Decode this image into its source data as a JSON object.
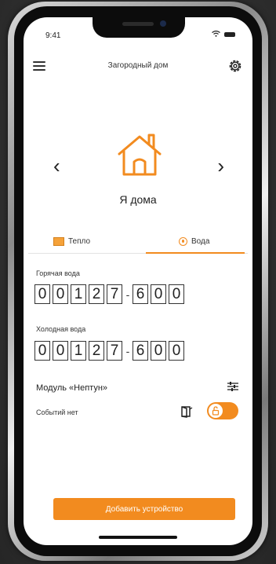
{
  "status_bar": {
    "time": "9:41"
  },
  "header": {
    "title": "Загородный дом"
  },
  "home": {
    "label": "Я дома"
  },
  "tabs": [
    {
      "label": "Тепло",
      "icon": "radiator-icon",
      "active": false
    },
    {
      "label": "Вода",
      "icon": "water-drop-icon",
      "active": true
    }
  ],
  "meters": [
    {
      "label": "Горячая вода",
      "digits": [
        "0",
        "0",
        "1",
        "2",
        "7"
      ],
      "separator": "-",
      "fraction": [
        "6",
        "0",
        "0"
      ]
    },
    {
      "label": "Холодная вода",
      "digits": [
        "0",
        "0",
        "1",
        "2",
        "7"
      ],
      "separator": "-",
      "fraction": [
        "6",
        "0",
        "0"
      ]
    }
  ],
  "module": {
    "name": "Модуль «Нептун»"
  },
  "events": {
    "text": "Событий нет"
  },
  "toggle": {
    "on": true
  },
  "actions": {
    "add_device_label": "Добавить устройство"
  },
  "colors": {
    "accent": "#f28b1f",
    "text": "#222222"
  }
}
